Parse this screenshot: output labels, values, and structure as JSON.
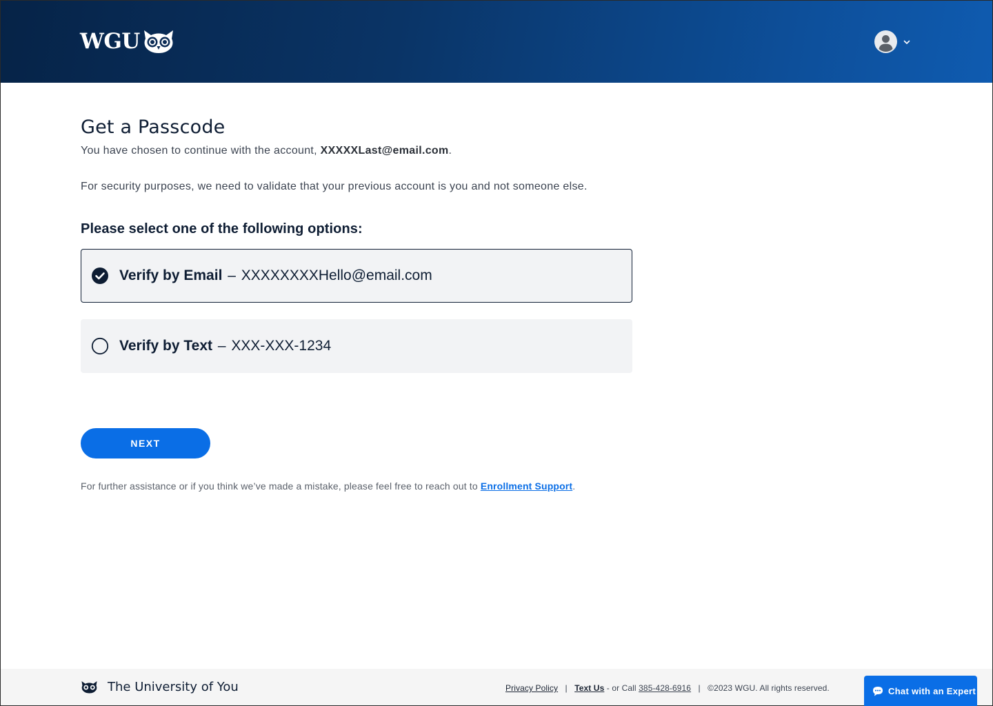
{
  "header": {
    "logo_text": "WGU",
    "logo_icon": "owl-logo-icon",
    "profile_icon": "user-avatar-icon",
    "menu_icon": "chevron-down-icon"
  },
  "main": {
    "title": "Get a Passcode",
    "intro_prefix": "You have chosen to continue with the account,",
    "account_email": "XXXXXLast@email.com",
    "intro_suffix": ".",
    "security_text": "For security purposes, we need to validate that your previous account is you and not someone else.",
    "options_heading": "Please select one of the following options:",
    "options": [
      {
        "label": "Verify by Email",
        "separator": "–",
        "value": "XXXXXXXXHello@email.com",
        "selected": true
      },
      {
        "label": "Verify by Text",
        "separator": "–",
        "value": "XXX-XXX-1234",
        "selected": false
      }
    ],
    "next_label": "NEXT",
    "assist_text": "For further assistance or if you think we’ve made a mistake, please feel free to reach out to",
    "assist_link": "Enrollment Support",
    "assist_suffix": "."
  },
  "footer": {
    "tagline": "The University of You",
    "privacy_label": "Privacy Policy",
    "sep": "|",
    "text_us_label": "Text Us",
    "call_prefix": "- or Call",
    "phone": "385-428-6916",
    "copyright": "©2023 WGU. All rights reserved.",
    "chat_label": "Chat with an Expert"
  },
  "colors": {
    "header_dark": "#062347",
    "header_light": "#0f5bb0",
    "accent": "#0a6ee6",
    "text_dark": "#0e1d33",
    "option_bg": "#f2f3f5"
  }
}
